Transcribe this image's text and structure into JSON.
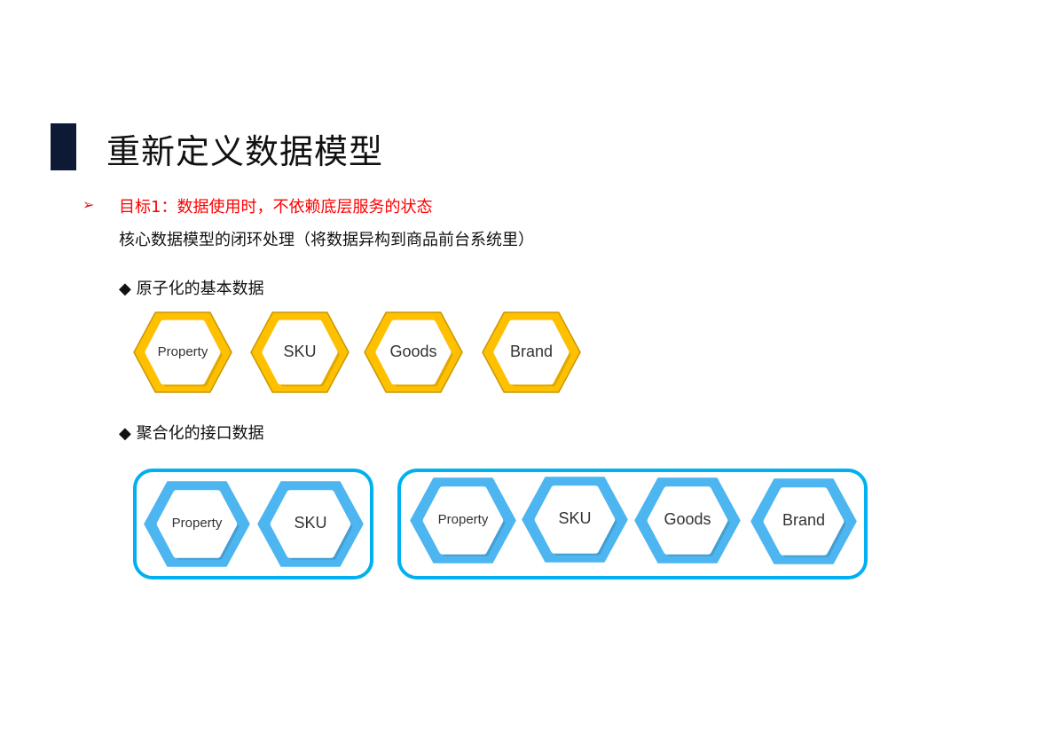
{
  "title": "重新定义数据模型",
  "goal": "目标1：数据使用时，不依赖底层服务的状态",
  "subtitle": "核心数据模型的闭环处理（将数据异构到商品前台系统里）",
  "section_atomic": {
    "marker": "◆",
    "label": "原子化的基本数据",
    "items": [
      "Property",
      "SKU",
      "Goods",
      "Brand"
    ]
  },
  "section_aggregate": {
    "marker": "◆",
    "label": "聚合化的接口数据",
    "groups": [
      {
        "items": [
          "Property",
          "SKU"
        ]
      },
      {
        "items": [
          "Property",
          "SKU",
          "Goods",
          "Brand"
        ]
      }
    ]
  },
  "colors": {
    "yellow": "#FFC000",
    "blue": "#4DB5F0",
    "box": "#00B0F0",
    "goal": "#FF0000"
  }
}
